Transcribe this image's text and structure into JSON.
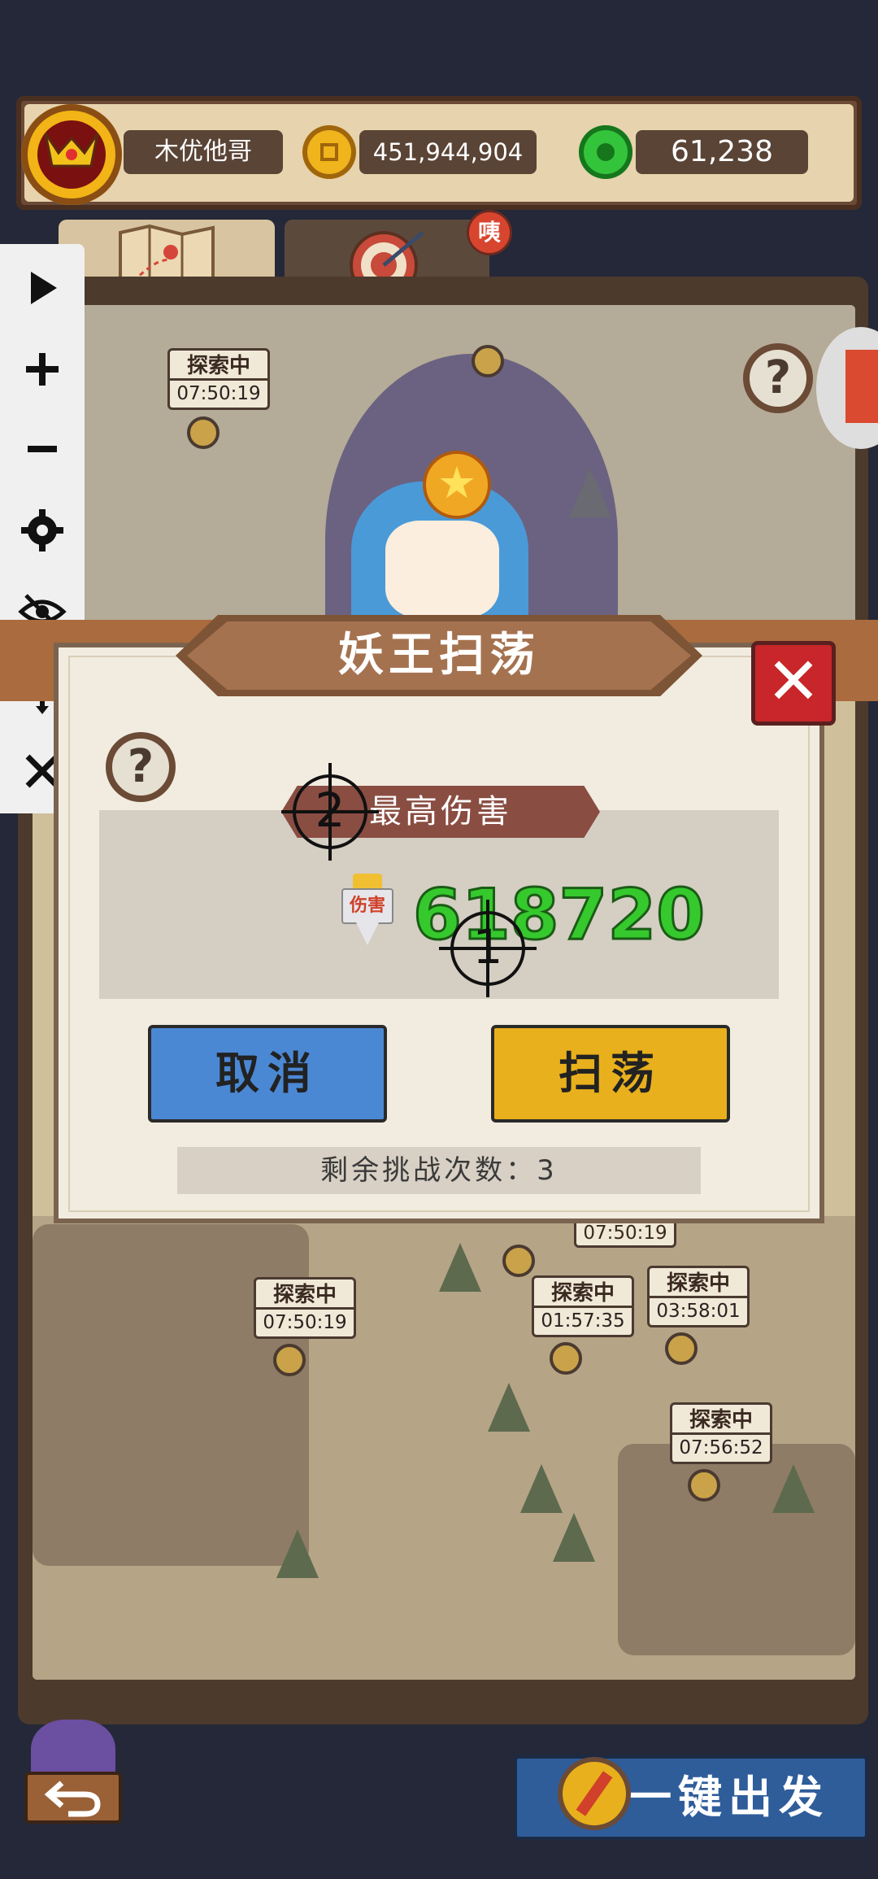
{
  "header": {
    "player_name": "木优他哥",
    "gold": "451,944,904",
    "jade": "61,238"
  },
  "tabs": {
    "badge_text": "咦"
  },
  "map": {
    "scouting_label": "探索中",
    "timers": [
      "07:50:19",
      "07:50:19",
      "01:57:35",
      "03:58:01",
      "07:56:52",
      "07:50:19"
    ]
  },
  "toolbar": {
    "items": [
      "play-icon",
      "zoom-in-icon",
      "zoom-out-icon",
      "gear-icon",
      "eye-off-icon",
      "move-icon",
      "close-icon"
    ]
  },
  "dialog": {
    "title": "妖王扫荡",
    "max_damage_label": "最高伤害",
    "damage_icon_text": "伤害",
    "damage_value": "618720",
    "cancel_label": "取消",
    "sweep_label": "扫荡",
    "remaining_text": "剩余挑战次数：3",
    "help_symbol": "?",
    "close_symbol": "✕"
  },
  "markers": {
    "m1": "1",
    "m2": "2"
  },
  "footer": {
    "go_label": "一键出发"
  },
  "colors": {
    "damage_green": "#35c92d",
    "cancel_blue": "#4b88d4",
    "sweep_gold": "#e8b01c",
    "close_red": "#c8262a"
  }
}
